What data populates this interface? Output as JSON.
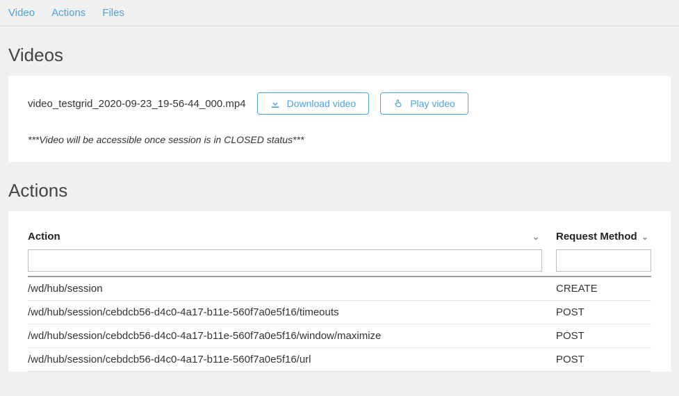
{
  "tabs": [
    {
      "label": "Video"
    },
    {
      "label": "Actions"
    },
    {
      "label": "Files"
    }
  ],
  "videos": {
    "heading": "Videos",
    "filename": "video_testgrid_2020-09-23_19-56-44_000.mp4",
    "download_label": "Download video",
    "play_label": "Play video",
    "note": "***Video will be accessible once session is in CLOSED status***"
  },
  "actions": {
    "heading": "Actions",
    "columns": {
      "action": "Action",
      "method": "Request Method"
    },
    "rows": [
      {
        "action": "/wd/hub/session",
        "method": "CREATE"
      },
      {
        "action": "/wd/hub/session/cebdcb56-d4c0-4a17-b11e-560f7a0e5f16/timeouts",
        "method": "POST"
      },
      {
        "action": "/wd/hub/session/cebdcb56-d4c0-4a17-b11e-560f7a0e5f16/window/maximize",
        "method": "POST"
      },
      {
        "action": "/wd/hub/session/cebdcb56-d4c0-4a17-b11e-560f7a0e5f16/url",
        "method": "POST"
      }
    ]
  }
}
